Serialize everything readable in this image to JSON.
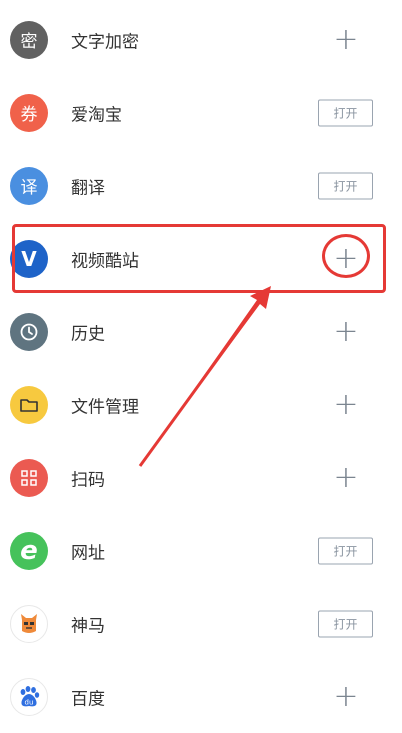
{
  "items": [
    {
      "glyph": "密",
      "label": "文字加密",
      "action": "add",
      "color": "#616161"
    },
    {
      "glyph": "券",
      "label": "爱淘宝",
      "action": "open",
      "button_label": "打开",
      "color": "#f0614a"
    },
    {
      "glyph": "译",
      "label": "翻译",
      "action": "open",
      "button_label": "打开",
      "color": "#4a8fe0"
    },
    {
      "glyph": "V",
      "label": "视频酷站",
      "action": "add",
      "color": "#1e63c8"
    },
    {
      "glyph": "",
      "label": "历史",
      "action": "add",
      "color": "#5f7480"
    },
    {
      "glyph": "",
      "label": "文件管理",
      "action": "add",
      "color": "#f7c93f"
    },
    {
      "glyph": "",
      "label": "扫码",
      "action": "add",
      "color": "#eb5a51"
    },
    {
      "glyph": "e",
      "label": "网址",
      "action": "open",
      "button_label": "打开",
      "color": "#46c25b"
    },
    {
      "glyph": "",
      "label": "神马",
      "action": "open",
      "button_label": "打开",
      "color": "#ef8a3a"
    },
    {
      "glyph": "du",
      "label": "百度",
      "action": "add",
      "color": "#2f6fe0"
    }
  ],
  "plus_glyph": "+",
  "annotation_color": "#e53935"
}
